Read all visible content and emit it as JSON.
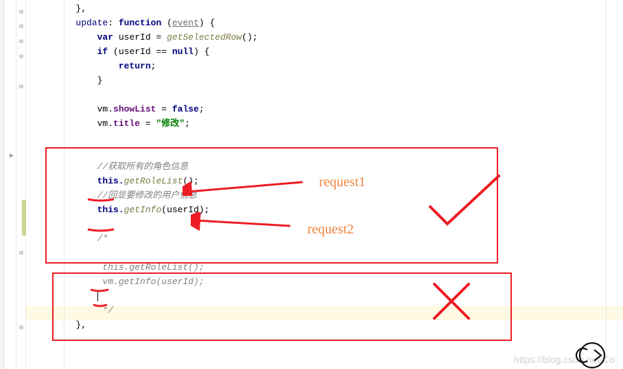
{
  "code": {
    "line1": "},",
    "line2_kw1": "update",
    "line2_kw2": "function",
    "line2_param": "event",
    "line3_kw": "var",
    "line3_var": "userId",
    "line3_fn": "getSelectedRow",
    "line4_kw1": "if",
    "line4_var": "userId",
    "line4_kw2": "null",
    "line5_kw": "return",
    "line8_vm": "vm.",
    "line8_field": "showList",
    "line8_kw": "false",
    "line9_vm": "vm.",
    "line9_field": "title",
    "line9_str": "\"修改\"",
    "comment1": "//获取所有的角色信息",
    "line_this1": "this.",
    "line_fn1": "getRoleList",
    "comment2": "//回显要修改的用户信息",
    "line_this2": "this.",
    "line_fn2": "getInfo",
    "line_param2": "userId",
    "comment_block_start": "/*",
    "comment_line1": " this.getRoleList();",
    "comment_line2": " vm.getInfo(userId);",
    "comment_block_end": " */",
    "close_brace": "},"
  },
  "annotations": {
    "request1": "request1",
    "request2": "request2"
  },
  "watermark": {
    "text": "https://blog.csdn.net/Co"
  }
}
